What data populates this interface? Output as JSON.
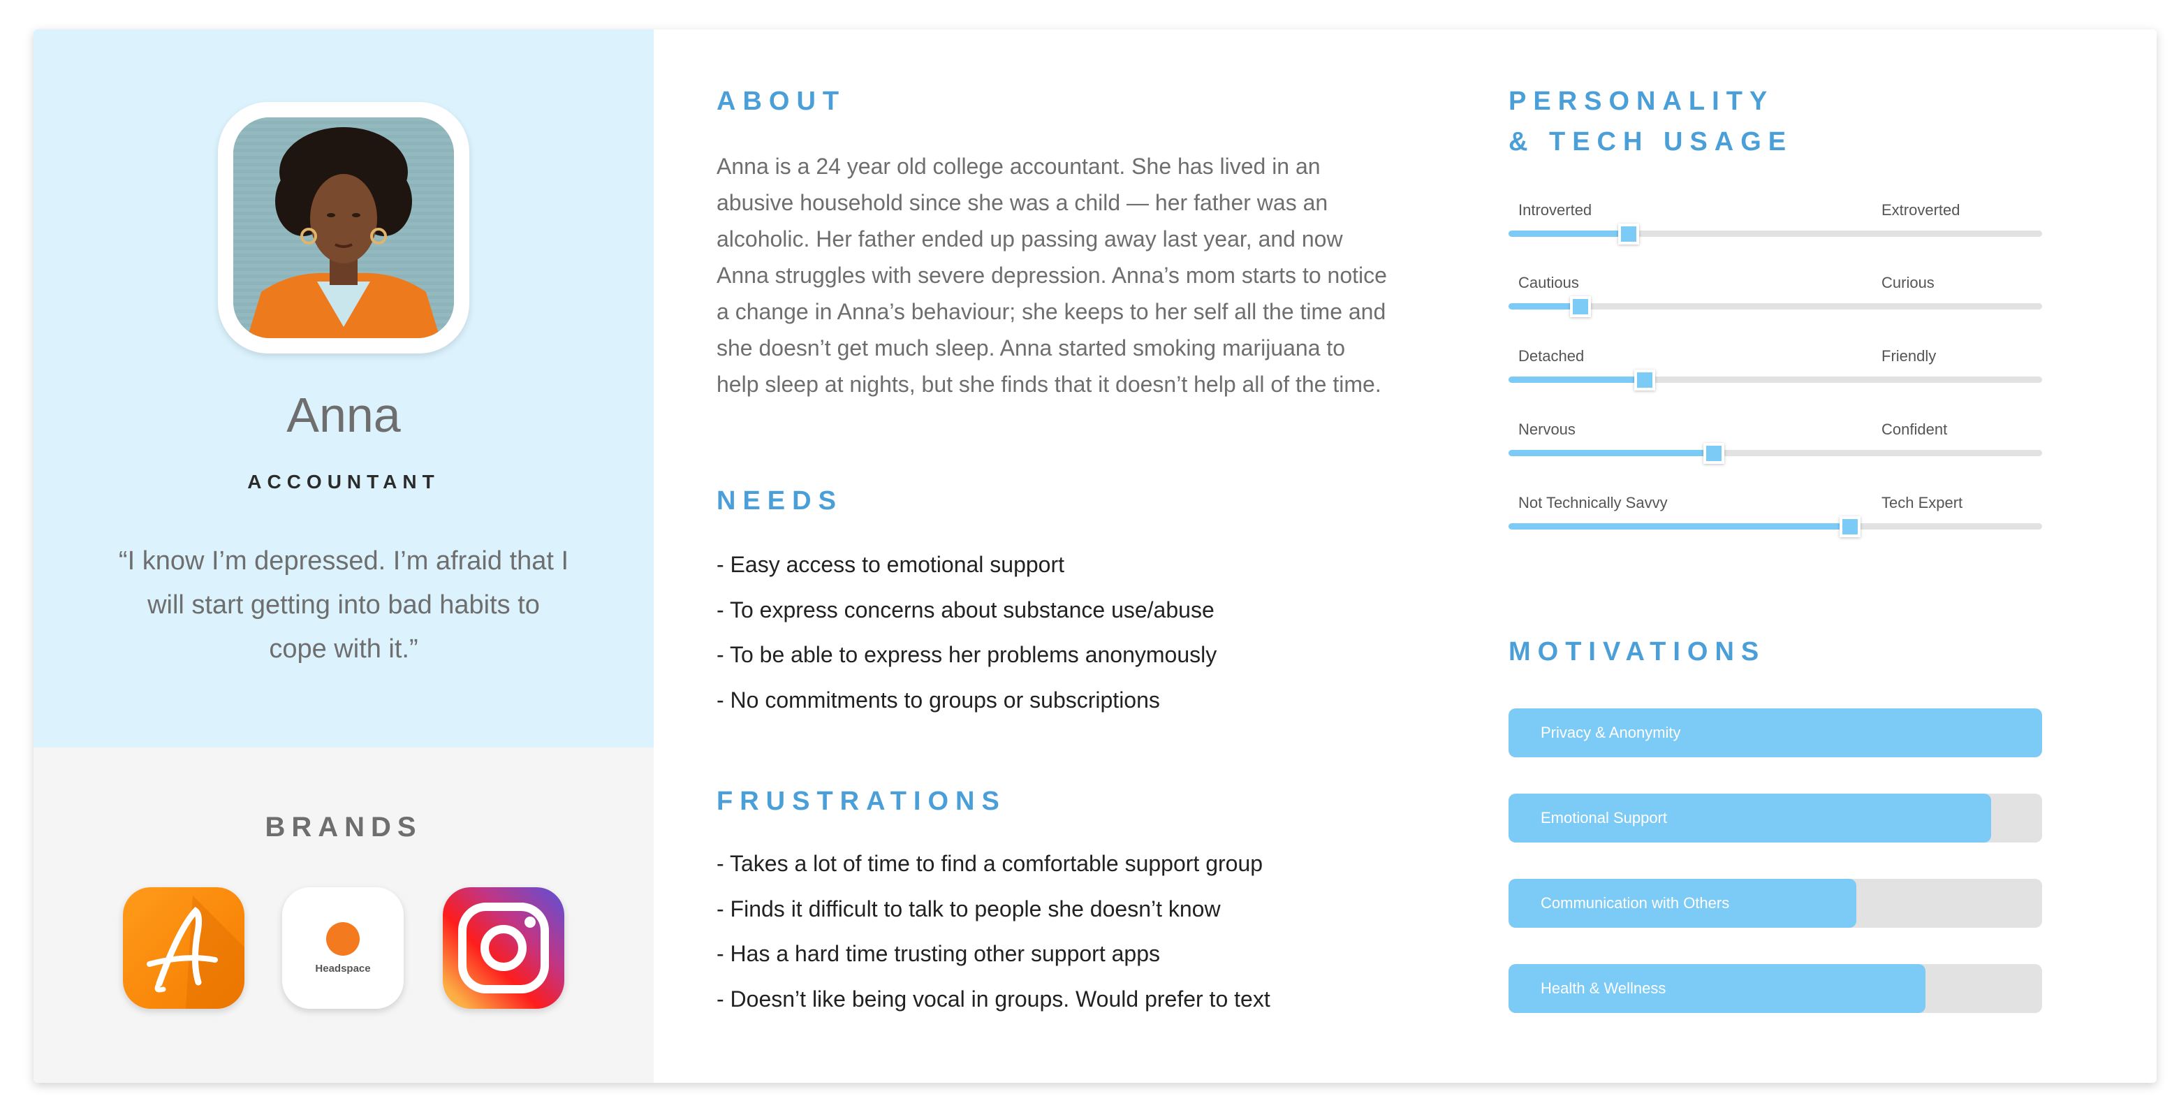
{
  "persona": {
    "name": "Anna",
    "role": "ACCOUNTANT",
    "quote": "“I know I’m depressed. I’m afraid that I will start getting into bad habits to cope with it.”"
  },
  "brands": {
    "title": "BRANDS",
    "items": [
      {
        "name": "A-letter-app-icon",
        "label": ""
      },
      {
        "name": "headspace-icon",
        "label": "Headspace"
      },
      {
        "name": "instagram-icon",
        "label": ""
      }
    ]
  },
  "about": {
    "title": "ABOUT",
    "text": "Anna is a 24 year old college accountant. She has lived in an abusive household since she was a child — her father was an alcoholic. Her father ended up passing away last year, and now Anna struggles with severe depression. Anna’s mom starts to notice a change in Anna’s behaviour; she keeps to her self all the time and she doesn’t get much sleep. Anna started smoking marijuana to help sleep at nights, but she finds that it doesn’t help all of the time."
  },
  "needs": {
    "title": "NEEDS",
    "items": [
      "- Easy access to emotional support",
      "- To express concerns about substance use/abuse",
      "- To be able to express her problems anonymously",
      "- No commitments to groups or subscriptions"
    ]
  },
  "frustrations": {
    "title": "FRUSTRATIONS",
    "items": [
      "- Takes a lot of time to find a comfortable support group",
      "- Finds it difficult to talk to people she doesn’t know",
      "- Has a hard time trusting other support apps",
      "- Doesn’t like being vocal in groups. Would prefer to text"
    ]
  },
  "personality": {
    "title_line1": "PERSONALITY",
    "title_line2": "& TECH USAGE",
    "traits": [
      {
        "left": "Introverted",
        "right": "Extroverted",
        "value": 0.22
      },
      {
        "left": "Cautious",
        "right": "Curious",
        "value": 0.13
      },
      {
        "left": "Detached",
        "right": "Friendly",
        "value": 0.25
      },
      {
        "left": "Nervous",
        "right": "Confident",
        "value": 0.38
      },
      {
        "left": "Not Technically Savvy",
        "right": "Tech Expert",
        "value": 0.635
      }
    ]
  },
  "motivations": {
    "title": "MOTIVATIONS",
    "items": [
      {
        "label": "Privacy & Anonymity",
        "value": 1.0
      },
      {
        "label": "Emotional Support",
        "value": 0.905
      },
      {
        "label": "Communication with Others",
        "value": 0.652
      },
      {
        "label": "Health & Wellness",
        "value": 0.782
      }
    ]
  },
  "colors": {
    "accent": "#4a9fd8",
    "slider_fill": "#7ccaf6",
    "profile_bg": "#dcf3fd",
    "brands_bg": "#f5f5f5"
  }
}
